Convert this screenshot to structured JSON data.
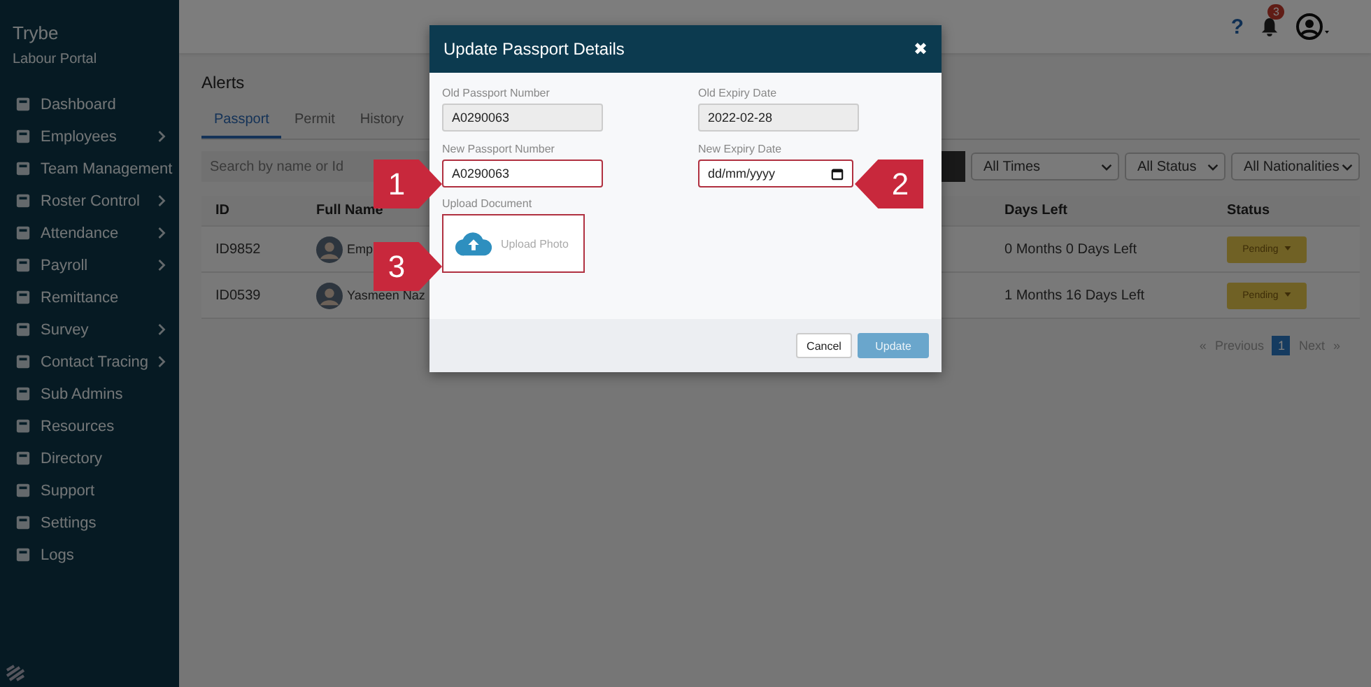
{
  "sidebar": {
    "brand": "Trybe",
    "subtitle": "Labour Portal",
    "items": [
      {
        "label": "Dashboard",
        "has_submenu": false
      },
      {
        "label": "Employees",
        "has_submenu": true
      },
      {
        "label": "Team Management",
        "has_submenu": false
      },
      {
        "label": "Roster Control",
        "has_submenu": true
      },
      {
        "label": "Attendance",
        "has_submenu": true
      },
      {
        "label": "Payroll",
        "has_submenu": true
      },
      {
        "label": "Remittance",
        "has_submenu": false
      },
      {
        "label": "Survey",
        "has_submenu": true
      },
      {
        "label": "Contact Tracing",
        "has_submenu": true
      },
      {
        "label": "Sub Admins",
        "has_submenu": false
      },
      {
        "label": "Resources",
        "has_submenu": false
      },
      {
        "label": "Directory",
        "has_submenu": false
      },
      {
        "label": "Support",
        "has_submenu": false
      },
      {
        "label": "Settings",
        "has_submenu": false
      },
      {
        "label": "Logs",
        "has_submenu": false
      }
    ]
  },
  "topbar": {
    "help": "?",
    "notification_count": "3"
  },
  "page": {
    "title": "Alerts",
    "tabs": [
      {
        "label": "Passport",
        "selected": true
      },
      {
        "label": "Permit",
        "selected": false
      },
      {
        "label": "History",
        "selected": false
      }
    ],
    "search": {
      "placeholder": "Search by name or Id"
    },
    "filters": [
      "All Times",
      "All Status",
      "All Nationalities"
    ],
    "table": {
      "columns": [
        "ID",
        "Full Name",
        "Days Left",
        "Status"
      ],
      "rows": [
        {
          "id": "ID9852",
          "name": "Emp",
          "days_left": "0 Months 0 Days Left",
          "status": "Pending"
        },
        {
          "id": "ID0539",
          "name": "Yasmeen Naz",
          "days_left": "1 Months 16 Days Left",
          "status": "Pending"
        }
      ]
    },
    "pagination": {
      "first": "«",
      "previous": "Previous",
      "pages": [
        {
          "label": "1",
          "selected": true
        }
      ],
      "next": "Next",
      "last": "»"
    }
  },
  "modal": {
    "title": "Update Passport Details",
    "close": "✖",
    "fields": [
      {
        "label": "Old Passport Number",
        "value": "A0290063",
        "kind": "readonly",
        "highlighted": false
      },
      {
        "label": "Old Expiry Date",
        "value": "2022-02-28",
        "kind": "readonly",
        "highlighted": false
      },
      {
        "label": "New Passport Number",
        "value": "A0290063",
        "kind": "text",
        "highlighted": true
      },
      {
        "label": "New Expiry Date",
        "placeholder": "dd/mm/yyyy",
        "kind": "date",
        "highlighted": true
      }
    ],
    "upload": {
      "label": "Upload Document",
      "button": "Upload Photo",
      "highlighted": true
    },
    "buttons": [
      {
        "label": "Cancel",
        "kind": "secondary"
      },
      {
        "label": "Update",
        "kind": "primary"
      }
    ]
  },
  "annotations": [
    {
      "number": "1",
      "kind": "pointer-right"
    },
    {
      "number": "2",
      "kind": "pointer-left"
    },
    {
      "number": "3",
      "kind": "pointer-right"
    }
  ]
}
